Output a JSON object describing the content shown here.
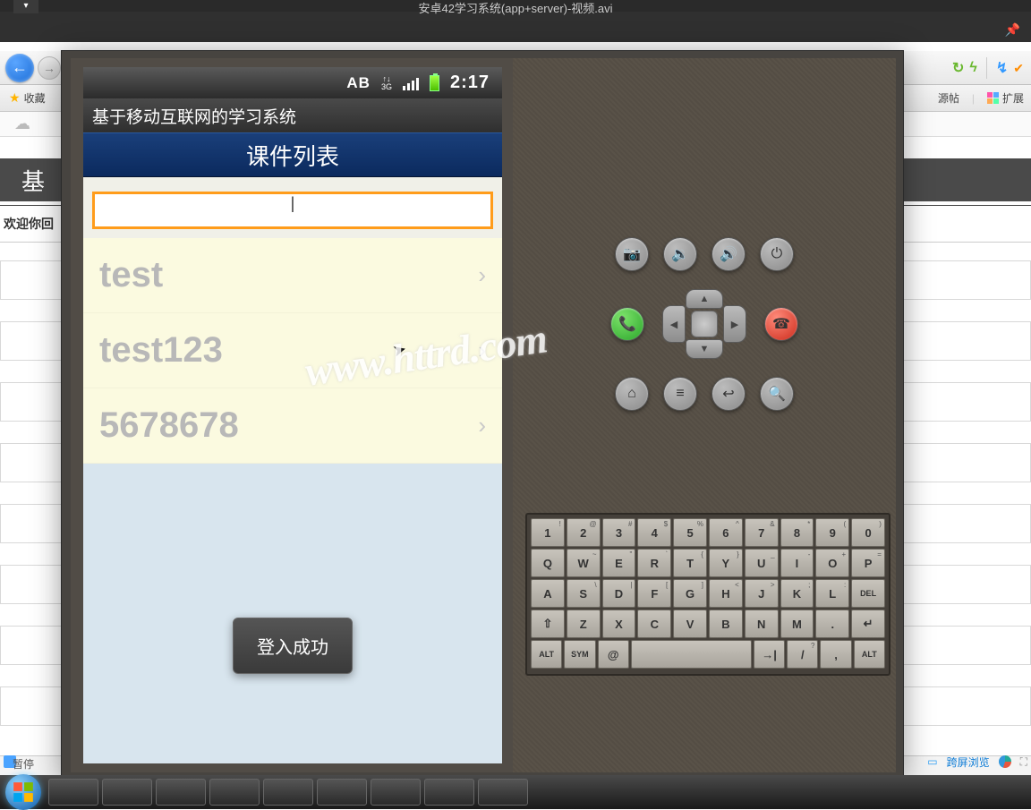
{
  "media": {
    "title": "安卓42学习系统(app+server)-视频.avi",
    "status": "暂停"
  },
  "browser": {
    "favorites_label": "收藏",
    "ext_label": "扩展",
    "source_label": "源帖",
    "cross_screen": "跨屏浏览"
  },
  "bg_page": {
    "heading": "基",
    "welcome": "欢迎你回"
  },
  "phone": {
    "status": {
      "ime": "AB",
      "net": "3G",
      "time": "2:17"
    },
    "app_title": "基于移动互联网的学习系统",
    "page_header": "课件列表",
    "search_value": "|",
    "items": [
      "test",
      "test123",
      "5678678"
    ],
    "toast": "登入成功"
  },
  "watermark": "www.httrd.com",
  "keyboard": {
    "row1": [
      {
        "m": "1",
        "a": "!"
      },
      {
        "m": "2",
        "a": "@"
      },
      {
        "m": "3",
        "a": "#"
      },
      {
        "m": "4",
        "a": "$"
      },
      {
        "m": "5",
        "a": "%"
      },
      {
        "m": "6",
        "a": "^"
      },
      {
        "m": "7",
        "a": "&"
      },
      {
        "m": "8",
        "a": "*"
      },
      {
        "m": "9",
        "a": "("
      },
      {
        "m": "0",
        "a": ")"
      }
    ],
    "row2": [
      {
        "m": "Q",
        "a": ""
      },
      {
        "m": "W",
        "a": "~"
      },
      {
        "m": "E",
        "a": "\""
      },
      {
        "m": "R",
        "a": "`"
      },
      {
        "m": "T",
        "a": "{"
      },
      {
        "m": "Y",
        "a": "}"
      },
      {
        "m": "U",
        "a": "_"
      },
      {
        "m": "I",
        "a": "-"
      },
      {
        "m": "O",
        "a": "+"
      },
      {
        "m": "P",
        "a": "="
      }
    ],
    "row3": [
      {
        "m": "A",
        "a": ""
      },
      {
        "m": "S",
        "a": "\\"
      },
      {
        "m": "D",
        "a": "|"
      },
      {
        "m": "F",
        "a": "["
      },
      {
        "m": "G",
        "a": "]"
      },
      {
        "m": "H",
        "a": "<"
      },
      {
        "m": "J",
        "a": ">"
      },
      {
        "m": "K",
        "a": ";"
      },
      {
        "m": "L",
        "a": ":"
      },
      {
        "m": "DEL",
        "a": ""
      }
    ],
    "row4": [
      {
        "m": "⇧",
        "a": ""
      },
      {
        "m": "Z",
        "a": ""
      },
      {
        "m": "X",
        "a": ""
      },
      {
        "m": "C",
        "a": ""
      },
      {
        "m": "V",
        "a": ""
      },
      {
        "m": "B",
        "a": ""
      },
      {
        "m": "N",
        "a": ""
      },
      {
        "m": "M",
        "a": ""
      },
      {
        "m": ".",
        "a": ""
      },
      {
        "m": "↵",
        "a": ""
      }
    ],
    "row5": [
      {
        "m": "ALT",
        "a": ""
      },
      {
        "m": "SYM",
        "a": ""
      },
      {
        "m": "@",
        "a": ""
      },
      {
        "m": " ",
        "a": ""
      },
      {
        "m": "→|",
        "a": ""
      },
      {
        "m": "/",
        "a": "?"
      },
      {
        "m": ",",
        "a": ""
      },
      {
        "m": "ALT",
        "a": ""
      }
    ]
  }
}
